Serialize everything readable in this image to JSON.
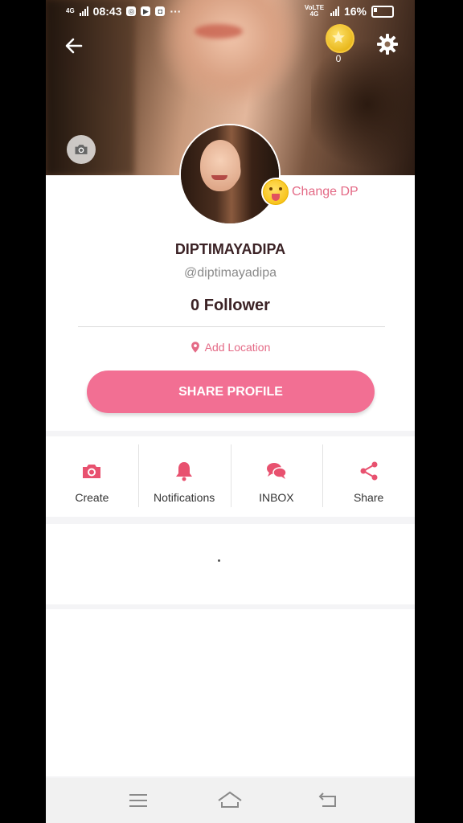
{
  "status_bar": {
    "time": "08:43",
    "network_left": "4G",
    "network_right": "VoLTE 4G",
    "battery": "16%"
  },
  "header": {
    "coin_count": "0",
    "icons": [
      "back-arrow-icon",
      "coin-icon",
      "gear-icon",
      "camera-icon"
    ]
  },
  "profile": {
    "change_dp_label": "Change DP",
    "display_name": "DIPTIMAYADIPA",
    "handle": "@diptimayadipa",
    "followers": "0 Follower",
    "add_location": "Add Location",
    "share_profile": "SHARE PROFILE"
  },
  "actions": [
    {
      "label": "Create",
      "icon": "camera-icon"
    },
    {
      "label": "Notifications",
      "icon": "bell-icon"
    },
    {
      "label": "INBOX",
      "icon": "chat-bubbles-icon"
    },
    {
      "label": "Share",
      "icon": "share-icon"
    }
  ],
  "nav_bar": {
    "icons": [
      "menu-icon",
      "home-icon",
      "back-icon"
    ]
  },
  "colors": {
    "accent": "#f26f93",
    "accent_text": "#e46a86",
    "heading": "#3b2225"
  }
}
